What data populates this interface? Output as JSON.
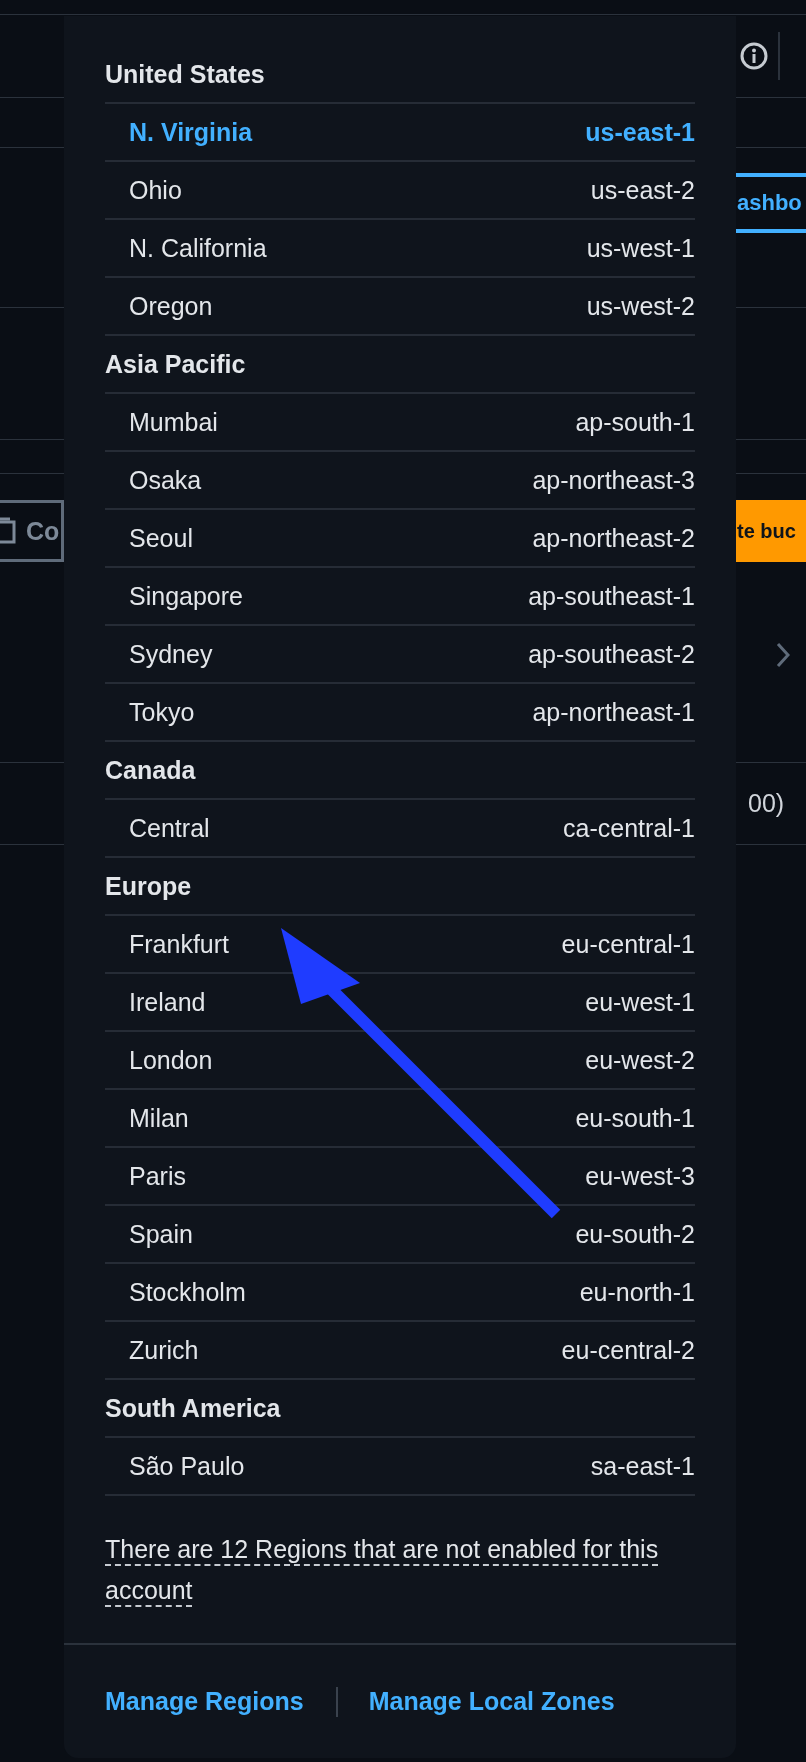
{
  "background": {
    "copy_button": {
      "label": "Co"
    },
    "tab": {
      "label": "ashbo",
      "selected": true
    },
    "primary_button": {
      "label": "te buc"
    },
    "count_text": "00)"
  },
  "region_menu": {
    "groups": [
      {
        "title": "United States",
        "regions": [
          {
            "name": "N. Virginia",
            "code": "us-east-1",
            "selected": true
          },
          {
            "name": "Ohio",
            "code": "us-east-2",
            "selected": false
          },
          {
            "name": "N. California",
            "code": "us-west-1",
            "selected": false
          },
          {
            "name": "Oregon",
            "code": "us-west-2",
            "selected": false
          }
        ]
      },
      {
        "title": "Asia Pacific",
        "regions": [
          {
            "name": "Mumbai",
            "code": "ap-south-1",
            "selected": false
          },
          {
            "name": "Osaka",
            "code": "ap-northeast-3",
            "selected": false
          },
          {
            "name": "Seoul",
            "code": "ap-northeast-2",
            "selected": false
          },
          {
            "name": "Singapore",
            "code": "ap-southeast-1",
            "selected": false
          },
          {
            "name": "Sydney",
            "code": "ap-southeast-2",
            "selected": false
          },
          {
            "name": "Tokyo",
            "code": "ap-northeast-1",
            "selected": false
          }
        ]
      },
      {
        "title": "Canada",
        "regions": [
          {
            "name": "Central",
            "code": "ca-central-1",
            "selected": false
          }
        ]
      },
      {
        "title": "Europe",
        "regions": [
          {
            "name": "Frankfurt",
            "code": "eu-central-1",
            "selected": false
          },
          {
            "name": "Ireland",
            "code": "eu-west-1",
            "selected": false
          },
          {
            "name": "London",
            "code": "eu-west-2",
            "selected": false
          },
          {
            "name": "Milan",
            "code": "eu-south-1",
            "selected": false
          },
          {
            "name": "Paris",
            "code": "eu-west-3",
            "selected": false
          },
          {
            "name": "Spain",
            "code": "eu-south-2",
            "selected": false
          },
          {
            "name": "Stockholm",
            "code": "eu-north-1",
            "selected": false
          },
          {
            "name": "Zurich",
            "code": "eu-central-2",
            "selected": false
          }
        ]
      },
      {
        "title": "South America",
        "regions": [
          {
            "name": "São Paulo",
            "code": "sa-east-1",
            "selected": false
          }
        ]
      }
    ],
    "note": "There are 12 Regions that are not enabled for this account",
    "footer_links": [
      "Manage Regions",
      "Manage Local Zones"
    ]
  }
}
